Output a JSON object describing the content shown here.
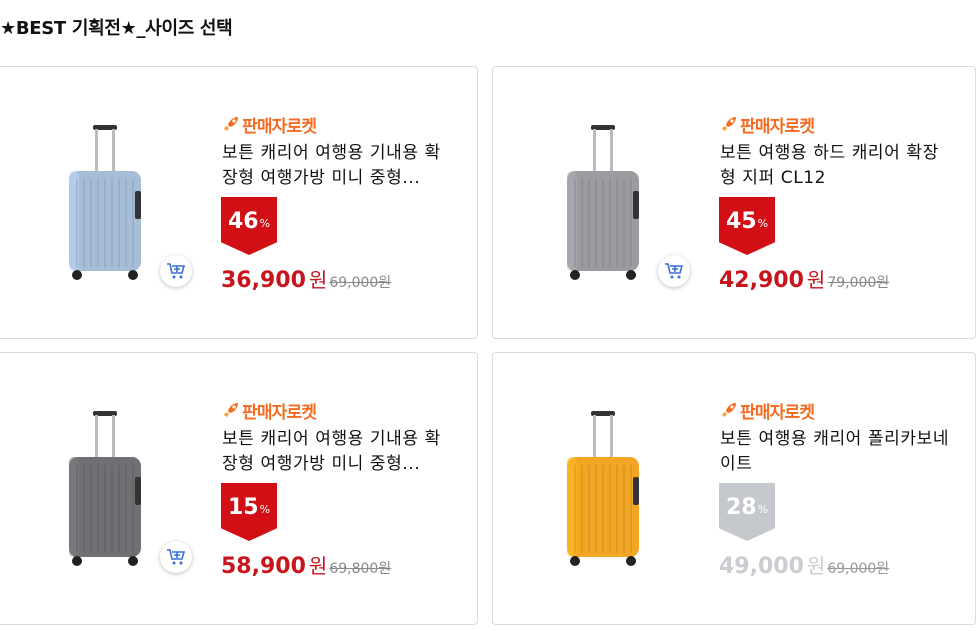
{
  "section": {
    "title": "★BEST 기획전★_사이즈 선택"
  },
  "products": [
    {
      "seller": "판매자로켓",
      "title": "보튼 캐리어 여행용 기내용 확장형 여행가방 미니 중형...",
      "discount": "46",
      "percent_sign": "%",
      "price": "36,900",
      "unit": "원",
      "original": "69,000원",
      "suitcase_color": "#a6bdd8",
      "style": "active"
    },
    {
      "seller": "판매자로켓",
      "title": "보튼 여행용 하드 캐리어 확장형 지퍼 CL12",
      "discount": "45",
      "percent_sign": "%",
      "price": "42,900",
      "unit": "원",
      "original": "79,000원",
      "suitcase_color": "#9a9ca0",
      "style": "active"
    },
    {
      "seller": "판매자로켓",
      "title": "보튼 캐리어 여행용 기내용 확장형 여행가방 미니 중형...",
      "discount": "15",
      "percent_sign": "%",
      "price": "58,900",
      "unit": "원",
      "original": "69,800원",
      "suitcase_color": "#6e7073",
      "style": "active"
    },
    {
      "seller": "판매자로켓",
      "title": "보튼 여행용 캐리어 폴리카보네이트",
      "discount": "28",
      "percent_sign": "%",
      "price": "49,000",
      "unit": "원",
      "original": "69,000원",
      "suitcase_color": "#f3a623",
      "style": "soldout"
    }
  ]
}
